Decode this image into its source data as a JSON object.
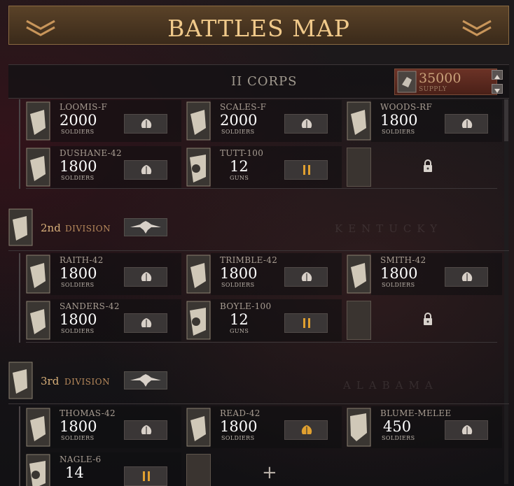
{
  "header": {
    "title": "BATTLES MAP"
  },
  "corps": {
    "title": "II CORPS",
    "supply_value": "35000",
    "supply_label": "SUPPLY"
  },
  "background_labels": [
    "KENTUCKY",
    "ALABAMA"
  ],
  "colors": {
    "accent": "#f0c98a",
    "title_bar": "#4a3520",
    "supply_box": "#5a2a1f",
    "action_active": "#e0a030"
  },
  "divisions": [
    {
      "units": [
        {
          "name": "LOOMIS-F",
          "count": "2000",
          "type": "SOLDIERS",
          "action_icon": "leaf-icon"
        },
        {
          "name": "SCALES-F",
          "count": "2000",
          "type": "SOLDIERS",
          "action_icon": "leaf-icon"
        },
        {
          "name": "WOODS-RF",
          "count": "1800",
          "type": "SOLDIERS",
          "action_icon": "leaf-icon"
        },
        {
          "name": "DUSHANE-42",
          "count": "1800",
          "type": "SOLDIERS",
          "action_icon": "leaf-icon"
        },
        {
          "name": "TUTT-100",
          "count": "12",
          "type": "GUNS",
          "action_icon": "upgrade-bars-icon"
        },
        {
          "slot": "locked",
          "icon": "lock-icon"
        }
      ]
    },
    {
      "num": "2nd",
      "word": "DIVISION",
      "units": [
        {
          "name": "RAITH-42",
          "count": "1800",
          "type": "SOLDIERS",
          "action_icon": "leaf-icon"
        },
        {
          "name": "TRIMBLE-42",
          "count": "1800",
          "type": "SOLDIERS",
          "action_icon": "leaf-icon"
        },
        {
          "name": "SMITH-42",
          "count": "1800",
          "type": "SOLDIERS",
          "action_icon": "leaf-icon"
        },
        {
          "name": "SANDERS-42",
          "count": "1800",
          "type": "SOLDIERS",
          "action_icon": "leaf-icon"
        },
        {
          "name": "BOYLE-100",
          "count": "12",
          "type": "GUNS",
          "action_icon": "upgrade-bars-icon"
        },
        {
          "slot": "locked",
          "icon": "lock-icon"
        }
      ]
    },
    {
      "num": "3rd",
      "word": "DIVISION",
      "units": [
        {
          "name": "THOMAS-42",
          "count": "1800",
          "type": "SOLDIERS",
          "action_icon": "leaf-icon"
        },
        {
          "name": "READ-42",
          "count": "1800",
          "type": "SOLDIERS",
          "action_icon": "leaf-icon-highlighted"
        },
        {
          "name": "BLUME-MELEE",
          "count": "450",
          "type": "SOLDIERS",
          "action_icon": "leaf-icon"
        },
        {
          "name": "NAGLE-6",
          "count": "14",
          "type": "",
          "action_icon": "upgrade-bars-icon"
        },
        {
          "slot": "add",
          "icon": "plus-icon",
          "label": "+"
        }
      ]
    }
  ]
}
